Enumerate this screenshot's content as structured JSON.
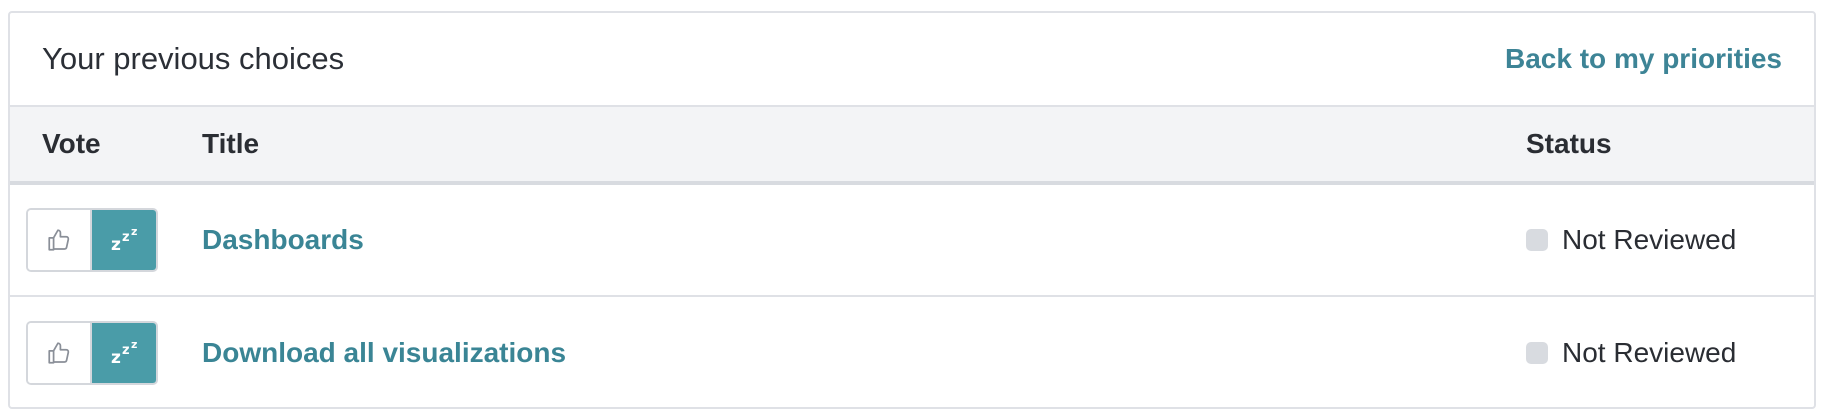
{
  "header": {
    "title": "Your previous choices",
    "back_link": "Back to my priorities"
  },
  "table": {
    "columns": {
      "vote": "Vote",
      "title": "Title",
      "status": "Status"
    },
    "rows": [
      {
        "title": "Dashboards",
        "status": "Not Reviewed",
        "vote_selected": "snooze"
      },
      {
        "title": "Download all visualizations",
        "status": "Not Reviewed",
        "vote_selected": "snooze"
      }
    ]
  },
  "icons": {
    "vote_up": "thumbs-up-icon",
    "vote_snooze": "zzz-snooze-icon"
  },
  "colors": {
    "accent": "#3d8496",
    "snooze_bg": "#4a9ca8",
    "status_dot": "#d8dbe0"
  }
}
